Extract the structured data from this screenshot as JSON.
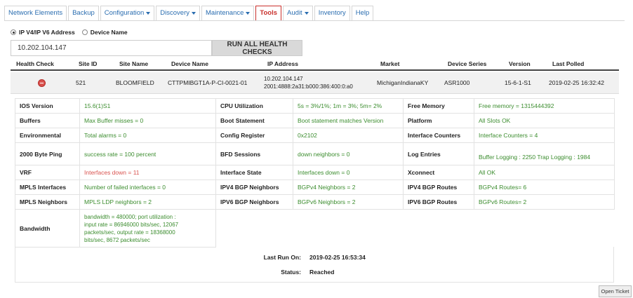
{
  "nav": {
    "tabs": [
      {
        "label": "Network Elements",
        "caret": false,
        "active": false
      },
      {
        "label": "Backup",
        "caret": false,
        "active": false
      },
      {
        "label": "Configuration",
        "caret": true,
        "active": false
      },
      {
        "label": "Discovery",
        "caret": true,
        "active": false
      },
      {
        "label": "Maintenance",
        "caret": true,
        "active": false
      },
      {
        "label": "Tools",
        "caret": false,
        "active": true
      },
      {
        "label": "Audit",
        "caret": true,
        "active": false
      },
      {
        "label": "Inventory",
        "caret": false,
        "active": false
      },
      {
        "label": "Help",
        "caret": false,
        "active": false
      }
    ]
  },
  "search": {
    "mode_ip_label": "IP V4/IP V6 Address",
    "mode_device_label": "Device Name",
    "selected_mode": "ip",
    "ip_value": "10.202.104.147",
    "run_button": "RUN ALL HEALTH CHECKS"
  },
  "summary": {
    "headers": {
      "health_check": "Health Check",
      "site_id": "Site ID",
      "site_name": "Site Name",
      "device_name": "Device Name",
      "ip_address": "IP Address",
      "market": "Market",
      "device_series": "Device Series",
      "version": "Version",
      "last_polled": "Last Polled"
    },
    "row": {
      "status_icon": "minus-circle-icon",
      "site_id": "521",
      "site_name": "BLOOMFIELD",
      "device_name": "CTTPMIBGT1A-P-CI-0021-01",
      "ip_v4": "10.202.104.147",
      "ip_v6": "2001:4888:2a31:b000:386:400:0:a0",
      "market": "MichiganIndianaKY",
      "device_series": "ASR1000",
      "version": "15-6-1-S1",
      "last_polled": "2019-02-25 16:32:42"
    }
  },
  "details": {
    "ios_version": {
      "label": "IOS Version",
      "value": "15.6(1)S1"
    },
    "cpu_utilization": {
      "label": "CPU Utilization",
      "value": "5s = 3%/1%; 1m = 3%; 5m= 2%"
    },
    "free_memory": {
      "label": "Free Memory",
      "value": "Free memory = 1315444392"
    },
    "buffers": {
      "label": "Buffers",
      "value": "Max Buffer misses = 0"
    },
    "boot_statement": {
      "label": "Boot Statement",
      "value": "Boot statement matches Version"
    },
    "platform": {
      "label": "Platform",
      "value": "All Slots OK"
    },
    "environmental": {
      "label": "Environmental",
      "value": "Total alarms = 0"
    },
    "config_register": {
      "label": "Config Register",
      "value": "0x2102"
    },
    "interface_counters": {
      "label": "Interface Counters",
      "value": "Interface Counters = 4"
    },
    "ping_2000": {
      "label": "2000 Byte Ping",
      "value": "success rate = 100 percent"
    },
    "bfd_sessions": {
      "label": "BFD Sessions",
      "value": "down neighbors = 0"
    },
    "log_entries": {
      "label": "Log Entries",
      "value": "Buffer Logging : 2250 Trap Logging : 1984"
    },
    "vrf": {
      "label": "VRF",
      "value": "Interfaces down = 11"
    },
    "interface_state": {
      "label": "Interface State",
      "value": "Interfaces down = 0"
    },
    "xconnect": {
      "label": "Xconnect",
      "value": "All OK"
    },
    "mpls_interfaces": {
      "label": "MPLS Interfaces",
      "value": "Number of failed interfaces = 0"
    },
    "ipv4_bgp_neighbors": {
      "label": "IPV4 BGP Neighbors",
      "value": "BGPv4 Neighbors = 2"
    },
    "ipv4_bgp_routes": {
      "label": "IPV4 BGP Routes",
      "value": "BGPv4 Routes= 6"
    },
    "mpls_neighbors": {
      "label": "MPLS Neighbors",
      "value": "MPLS LDP neighbors = 2"
    },
    "ipv6_bgp_neighbors": {
      "label": "IPV6 BGP Neighbors",
      "value": "BGPv6 Neighbors = 2"
    },
    "ipv6_bgp_routes": {
      "label": "IPV6 BGP Routes",
      "value": "BGPv6 Routes= 2"
    },
    "bandwidth": {
      "label": "Bandwidth",
      "lines": [
        "bandwidth = 480000; port utilization :",
        "input rate = 86946000 bits/sec, 12067",
        "packets/sec, output rate = 18368000",
        "bits/sec, 8672 packets/sec"
      ]
    }
  },
  "run_info": {
    "last_run_label": "Last Run On:",
    "last_run_value": "2019-02-25 16:53:34",
    "status_label": "Status:",
    "status_value": "Reached"
  },
  "open_ticket": "Open Ticket",
  "colors": {
    "link": "#2a6db0",
    "active_tab": "#c9302c",
    "ok_value": "#3c8d2f",
    "error_value": "#d9534f"
  }
}
